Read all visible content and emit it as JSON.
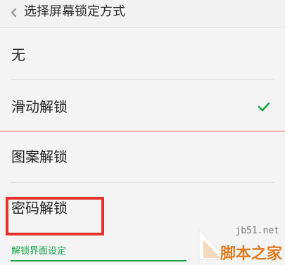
{
  "header": {
    "title": "选择屏幕锁定方式",
    "back_icon": "chevron-left-icon"
  },
  "options": [
    {
      "label": "无",
      "selected": false
    },
    {
      "label": "滑动解锁",
      "selected": true
    },
    {
      "label": "图案解锁",
      "selected": false
    },
    {
      "label": "密码解锁",
      "selected": false
    }
  ],
  "section": {
    "label": "解锁界面设定"
  },
  "colors": {
    "accent": "#19a64a",
    "divider_red": "#e8584f",
    "highlight": "#e5322d",
    "watermark": "#e17b22"
  },
  "watermark": {
    "url": "jb51.net",
    "name": "脚本之家"
  }
}
